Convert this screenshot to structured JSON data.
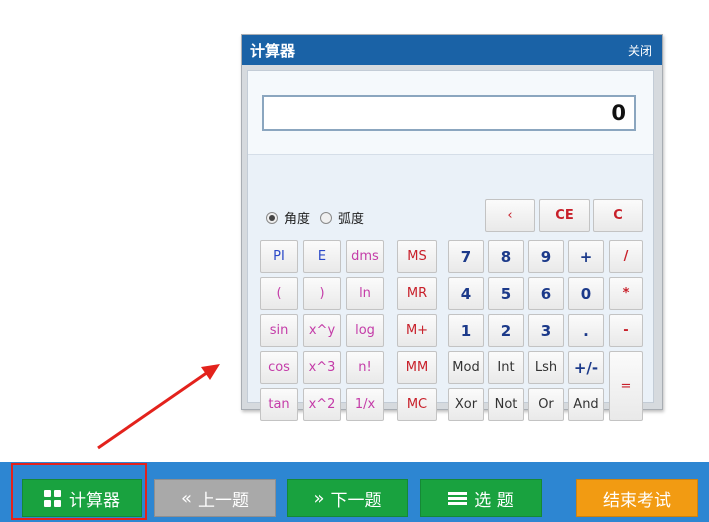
{
  "calculator": {
    "title": "计算器",
    "close_label": "关闭",
    "display_value": "0",
    "angle_modes": [
      {
        "label": "角度",
        "checked": true
      },
      {
        "label": "弧度",
        "checked": false
      }
    ],
    "top_keys": [
      "‹",
      "CE",
      "C"
    ],
    "sci_keys": [
      [
        "PI",
        "E",
        "dms"
      ],
      [
        "(",
        ")",
        "ln"
      ],
      [
        "sin",
        "x^y",
        "log"
      ],
      [
        "cos",
        "x^3",
        "n!"
      ],
      [
        "tan",
        "x^2",
        "1/x"
      ]
    ],
    "memory_keys": [
      "MS",
      "MR",
      "M+",
      "MM",
      "MC"
    ],
    "num_keys": [
      [
        "7",
        "8",
        "9",
        "+",
        "/"
      ],
      [
        "4",
        "5",
        "6",
        "0",
        "*"
      ],
      [
        "1",
        "2",
        "3",
        ".",
        "-"
      ],
      [
        "Mod",
        "Int",
        "Lsh",
        "+/-"
      ],
      [
        "Xor",
        "Not",
        "Or",
        "And"
      ]
    ],
    "equals_label": "="
  },
  "bottom_bar": {
    "calculator_button": "计算器",
    "prev_button": "上一题",
    "next_button": "下一题",
    "select_button": "选 题",
    "finish_button": "结束考试"
  },
  "colors": {
    "title_bar": "#1a62a6",
    "bottom_bar": "#2d86d2",
    "green_button": "#19a23f",
    "gray_button": "#a9a9a9",
    "orange_button": "#f29b12",
    "highlight_red": "#e3221c"
  },
  "icons": {
    "calculator_button": "grid-icon",
    "prev_button": "double-chevron-left-icon",
    "next_button": "double-chevron-right-icon",
    "select_button": "list-icon"
  }
}
